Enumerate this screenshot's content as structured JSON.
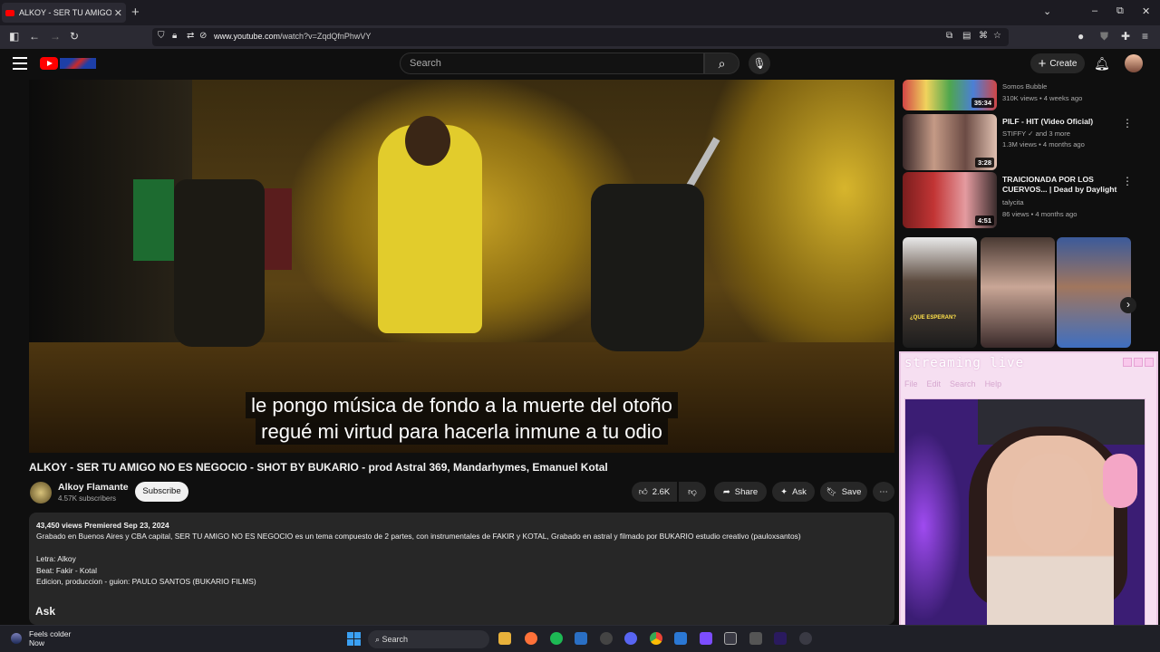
{
  "browser": {
    "tab_title": "ALKOY - SER TU AMIGO NO ES",
    "new_tab": "+",
    "url_host": "www.youtube.com",
    "url_path": "/watch?v=ZqdQfnPhwVY",
    "window_controls": [
      "⌄",
      "–",
      "⧉",
      "✕"
    ]
  },
  "header": {
    "search_placeholder": "Search",
    "create_label": "Create"
  },
  "video": {
    "subtitle_line1": "le pongo música de fondo a la muerte del otoño",
    "subtitle_line2": "regué mi virtud para hacerla inmune a tu odio",
    "title": "ALKOY - SER TU AMIGO NO ES NEGOCIO - SHOT BY BUKARIO - prod Astral 369, Mandarhymes, Emanuel Kotal"
  },
  "channel": {
    "name": "Alkoy Flamante",
    "subscribers": "4.57K subscribers",
    "subscribe_label": "Subscribe"
  },
  "actions": {
    "likes": "2.6K",
    "share": "Share",
    "ask": "Ask",
    "save": "Save"
  },
  "description": {
    "meta": "43,450 views  Premiered Sep 23, 2024",
    "line1": "Grabado en Buenos Aires y CBA capital, SER TU AMIGO NO ES NEGOCIO es un tema compuesto de 2 partes, con instrumentales de FAKIR y KOTAL, Grabado en astral y filmado por BUKARIO estudio creativo (pauloxsantos)",
    "line2": "Letra: Alkoy",
    "line3": "Beat: Fakir - Kotal",
    "line4": "Edicion, produccion - guion: PAULO SANTOS (BUKARIO FILMS)"
  },
  "ask_section": "Ask",
  "recommendations": [
    {
      "title": "",
      "channel": "Somos Bubble",
      "views": "310K views • 4 weeks ago",
      "duration": "35:34"
    },
    {
      "title": "PILF - HIT (Video Oficial)",
      "channel": "STIFFY ✓ and 3 more",
      "views": "1.3M views • 4 months ago",
      "duration": "3:28"
    },
    {
      "title": "TRAICIONADA POR LOS CUERVOS... | Dead by Daylight",
      "channel": "talycita",
      "views": "86 views • 4 months ago",
      "duration": "4:51"
    }
  ],
  "shorts": [
    {
      "caption": "¿QUE ESPERAN?"
    },
    {
      "caption": ""
    },
    {
      "caption": ""
    }
  ],
  "stream_overlay": {
    "title": "streaming live",
    "menu": [
      "File",
      "Edit",
      "Search",
      "Help"
    ]
  },
  "taskbar": {
    "weather_label": "Feels colder",
    "weather_time": "Now",
    "search_label": "Search"
  }
}
